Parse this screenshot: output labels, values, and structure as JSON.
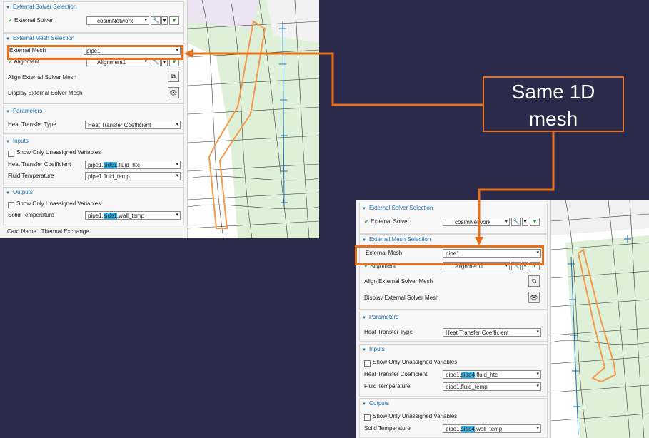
{
  "callout": {
    "line1": "Same 1D",
    "line2": "mesh"
  },
  "colors": {
    "accent_orange": "#e8701a",
    "section_blue": "#1f6fa8",
    "highlight": "#38b6e8",
    "background": "#2b2a4a"
  },
  "left_panel": {
    "ext_solver_section": "External Solver Selection",
    "ext_solver_label": "External Solver",
    "ext_solver_value": "cosimNetwork",
    "ext_mesh_section": "External Mesh Selection",
    "ext_mesh_label": "External Mesh",
    "ext_mesh_value": "pipe1",
    "alignment_label": "Alignment",
    "alignment_value": "Alignment1",
    "align_mesh_label": "Align External Solver Mesh",
    "display_mesh_label": "Display External Solver Mesh",
    "parameters_section": "Parameters",
    "htt_label": "Heat Transfer Type",
    "htt_value": "Heat Transfer Coefficient",
    "inputs_section": "Inputs",
    "show_unassigned": "Show Only Unassigned Variables",
    "htc_label": "Heat Transfer Coefficient",
    "htc_pre": "pipe1.",
    "htc_hl": "side1",
    "htc_post": ".fluid_htc",
    "ft_label": "Fluid Temperature",
    "ft_value": "pipe1.fluid_temp",
    "outputs_section": "Outputs",
    "show_unassigned_out": "Show Only Unassigned Variables",
    "st_label": "Solid Temperature",
    "st_pre": "pipe1.",
    "st_hl": "side1",
    "st_post": ".wall_temp",
    "card_name": "Card Name",
    "card_value": "Thermal Exchange"
  },
  "right_panel": {
    "ext_solver_section": "External Solver Selection",
    "ext_solver_label": "External Solver",
    "ext_solver_value": "cosimNetwork",
    "ext_mesh_section": "External Mesh Selection",
    "ext_mesh_label": "External Mesh",
    "ext_mesh_value": "pipe1",
    "alignment_label": "Alignment",
    "alignment_value": "Alignment1",
    "align_mesh_label": "Align External Solver Mesh",
    "display_mesh_label": "Display External Solver Mesh",
    "parameters_section": "Parameters",
    "htt_label": "Heat Transfer Type",
    "htt_value": "Heat Transfer Coefficient",
    "inputs_section": "Inputs",
    "show_unassigned": "Show Only Unassigned Variables",
    "htc_label": "Heat Transfer Coefficient",
    "htc_pre": "pipe1.",
    "htc_hl": "side4",
    "htc_post": ".fluid_htc",
    "ft_label": "Fluid Temperature",
    "ft_value": "pipe1.fluid_temp",
    "outputs_section": "Outputs",
    "show_unassigned_out": "Show Only Unassigned Variables",
    "st_label": "Solid Temperature",
    "st_pre": "pipe1.",
    "st_hl": "side4",
    "st_post": ".wall_temp"
  }
}
